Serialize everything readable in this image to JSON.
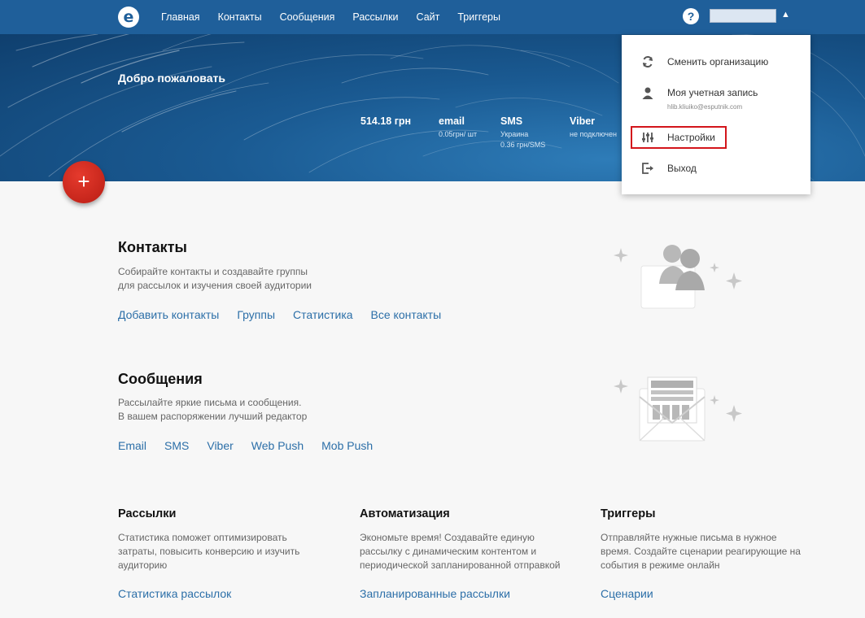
{
  "nav": {
    "logo_letter": "e",
    "items": [
      {
        "label": "Главная"
      },
      {
        "label": "Контакты"
      },
      {
        "label": "Сообщения"
      },
      {
        "label": "Рассылки"
      },
      {
        "label": "Сайт"
      },
      {
        "label": "Триггеры"
      }
    ],
    "help_icon": "?",
    "caret": "▲"
  },
  "hero": {
    "welcome": "Добро пожаловать",
    "balance": "514.18 грн",
    "channels": [
      {
        "name": "email",
        "lines": [
          "0.05грн/ шт"
        ]
      },
      {
        "name": "SMS",
        "lines": [
          "Украина",
          "0.36 грн/SMS"
        ]
      },
      {
        "name": "Viber",
        "lines": [
          "не подключен"
        ]
      }
    ]
  },
  "fab": {
    "label": "+"
  },
  "dropdown": {
    "items": [
      {
        "label": "Сменить организацию",
        "icon": "sync-icon"
      },
      {
        "label": "Моя учетная запись",
        "sub": "hlib.kliuiko@esputnik.com",
        "icon": "user-icon"
      },
      {
        "label": "Настройки",
        "icon": "sliders-icon"
      },
      {
        "label": "Выход",
        "icon": "logout-icon"
      }
    ]
  },
  "contacts": {
    "title": "Контакты",
    "desc": [
      "Собирайте контакты и создавайте группы",
      "для рассылок и изучения своей аудитории"
    ],
    "links": [
      "Добавить контакты",
      "Группы",
      "Статистика",
      "Все контакты"
    ]
  },
  "messages": {
    "title": "Сообщения",
    "desc": [
      "Рассылайте яркие письма и сообщения.",
      "В вашем распоряжении лучший редактор"
    ],
    "links": [
      "Email",
      "SMS",
      "Viber",
      "Web Push",
      "Mob Push"
    ]
  },
  "columns": [
    {
      "title": "Рассылки",
      "desc": [
        "Статистика поможет оптимизировать",
        "затраты, повысить конверсию и изучить",
        "аудиторию"
      ],
      "link": "Статистика рассылок"
    },
    {
      "title": "Автоматизация",
      "desc": [
        "Экономьте время! Создавайте единую",
        "рассылку с динамическим контентом и",
        "периодической запланированной отправкой"
      ],
      "link": "Запланированные рассылки"
    },
    {
      "title": "Триггеры",
      "desc": [
        "Отправляйте нужные письма в нужное",
        "время. Создайте сценарии реагирующие на",
        "события в режиме онлайн"
      ],
      "link": "Сценарии"
    }
  ],
  "colors": {
    "nav": "#1f5f9a",
    "accent_red": "#d3151b",
    "link": "#2c6fa8"
  }
}
